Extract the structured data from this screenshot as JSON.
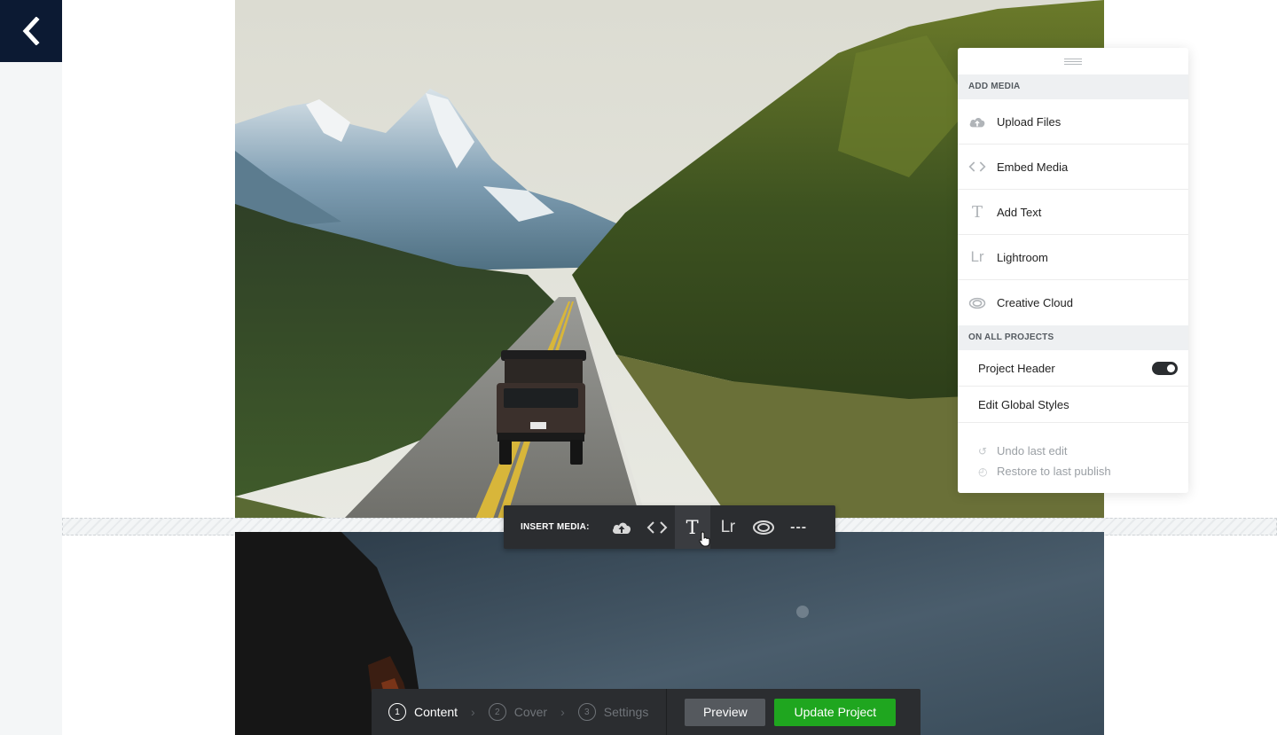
{
  "nav": {
    "back_icon": "chevron-left-icon"
  },
  "insert_toolbar": {
    "label": "INSERT MEDIA:",
    "buttons": [
      {
        "icon": "cloud-upload-icon"
      },
      {
        "icon": "code-embed-icon"
      },
      {
        "icon": "text-icon",
        "glyph": "T"
      },
      {
        "icon": "lightroom-icon",
        "glyph": "Lr"
      },
      {
        "icon": "creative-cloud-icon"
      },
      {
        "icon": "more-icon",
        "glyph": "---"
      }
    ]
  },
  "panel": {
    "add_media_header": "ADD MEDIA",
    "media_items": [
      {
        "label": "Upload Files",
        "icon": "cloud-upload-icon"
      },
      {
        "label": "Embed Media",
        "icon": "code-embed-icon"
      },
      {
        "label": "Add Text",
        "icon": "text-icon",
        "glyph": "T"
      },
      {
        "label": "Lightroom",
        "icon": "lightroom-icon",
        "glyph": "Lr"
      },
      {
        "label": "Creative Cloud",
        "icon": "creative-cloud-icon"
      }
    ],
    "all_projects_header": "ON ALL PROJECTS",
    "project_header_label": "Project Header",
    "project_header_on": true,
    "edit_global_styles": "Edit Global Styles",
    "undo_label": "Undo last edit",
    "restore_label": "Restore to last publish"
  },
  "bottom_bar": {
    "steps": [
      {
        "num": "1",
        "label": "Content",
        "active": true
      },
      {
        "num": "2",
        "label": "Cover",
        "active": false
      },
      {
        "num": "3",
        "label": "Settings",
        "active": false
      }
    ],
    "preview_label": "Preview",
    "update_label": "Update Project"
  },
  "colors": {
    "nav_bg": "#0c1a33",
    "toolbar_bg": "#2b2d30",
    "update_green": "#1fa61f"
  }
}
